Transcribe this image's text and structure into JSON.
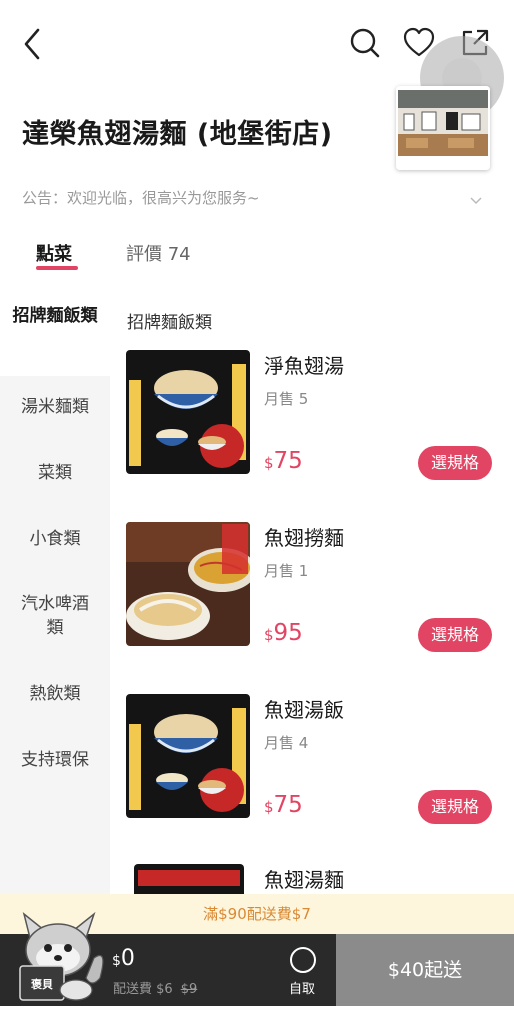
{
  "topbar": {
    "back_icon": "chevron-left-icon",
    "search_icon": "search-icon",
    "favorite_icon": "heart-icon",
    "share_icon": "share-icon"
  },
  "store": {
    "name": "達榮魚翅湯麵 (地堡街店)",
    "notice": "公告：欢迎光临，很高兴为您服务~"
  },
  "tabs": [
    {
      "label": "點菜",
      "active": true
    },
    {
      "label": "評價 74",
      "active": false
    }
  ],
  "categories": [
    {
      "label": "招牌麵飯類",
      "active": true
    },
    {
      "label": "湯米麵類",
      "active": false
    },
    {
      "label": "菜類",
      "active": false
    },
    {
      "label": "小食類",
      "active": false
    },
    {
      "label": "汽水啤酒類",
      "active": false
    },
    {
      "label": "熱飲類",
      "active": false
    },
    {
      "label": "支持環保",
      "active": false
    }
  ],
  "section_title": "招牌麵飯類",
  "dishes": [
    {
      "name": "淨魚翅湯",
      "sold": "月售 5",
      "currency": "$",
      "price": "75",
      "button": "選規格"
    },
    {
      "name": "魚翅撈麵",
      "sold": "月售 1",
      "currency": "$",
      "price": "95",
      "button": "選規格"
    },
    {
      "name": "魚翅湯飯",
      "sold": "月售 4",
      "currency": "$",
      "price": "75",
      "button": "選規格"
    },
    {
      "name": "魚翅湯麵",
      "sold": "",
      "currency": "$",
      "price": "",
      "button": ""
    }
  ],
  "promo": "滿$90配送費$7",
  "cart": {
    "currency": "$",
    "total": "0",
    "fee_label": "配送費 $6",
    "fee_original": "$9",
    "pickup_label": "自取",
    "checkout_label": "$40起送",
    "mascot_badge": "褒貝"
  },
  "colors": {
    "accent": "#e24563",
    "promo_bg": "#fdf5dc",
    "promo_text": "#d98a35",
    "cartbar_bg": "#2a2a2a",
    "checkout_bg": "#8b8b8b"
  }
}
